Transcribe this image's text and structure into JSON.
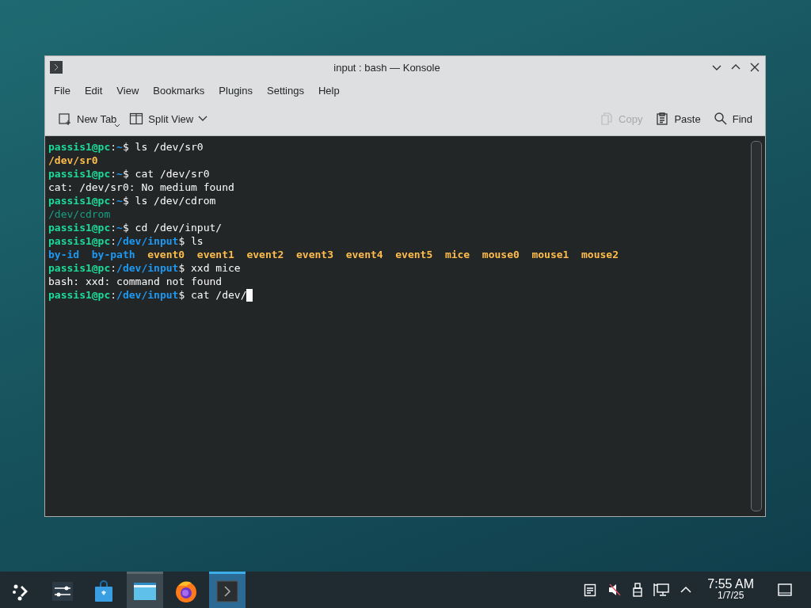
{
  "window": {
    "title": "input : bash — Konsole"
  },
  "menu": [
    "File",
    "Edit",
    "View",
    "Bookmarks",
    "Plugins",
    "Settings",
    "Help"
  ],
  "toolbar": [
    {
      "kind": "new-tab",
      "label": "New Tab",
      "disabled": false
    },
    {
      "kind": "split-view",
      "label": "Split View",
      "disabled": false
    },
    {
      "kind": "copy",
      "label": "Copy",
      "disabled": true
    },
    {
      "kind": "paste",
      "label": "Paste",
      "disabled": false
    },
    {
      "kind": "find",
      "label": "Find",
      "disabled": false
    }
  ],
  "terminal": {
    "lines": [
      {
        "kind": "command",
        "segments": [
          {
            "text": "passis1@pc",
            "kind": "user"
          },
          {
            "text": ":",
            "kind": "plain"
          },
          {
            "text": "~",
            "kind": "path"
          },
          {
            "text": "$ ls /dev/sr0",
            "kind": "plain"
          }
        ]
      },
      {
        "kind": "output",
        "segments": [
          {
            "text": "/dev/sr0",
            "kind": "device"
          }
        ]
      },
      {
        "kind": "command",
        "segments": [
          {
            "text": "passis1@pc",
            "kind": "user"
          },
          {
            "text": ":",
            "kind": "plain"
          },
          {
            "text": "~",
            "kind": "path"
          },
          {
            "text": "$ cat /dev/sr0",
            "kind": "plain"
          }
        ]
      },
      {
        "kind": "output",
        "segments": [
          {
            "text": "cat: /dev/sr0: No medium found",
            "kind": "plain"
          }
        ]
      },
      {
        "kind": "command",
        "segments": [
          {
            "text": "passis1@pc",
            "kind": "user"
          },
          {
            "text": ":",
            "kind": "plain"
          },
          {
            "text": "~",
            "kind": "path"
          },
          {
            "text": "$ ls /dev/cdrom",
            "kind": "plain"
          }
        ]
      },
      {
        "kind": "output",
        "segments": [
          {
            "text": "/dev/cdrom",
            "kind": "link"
          }
        ]
      },
      {
        "kind": "command",
        "segments": [
          {
            "text": "passis1@pc",
            "kind": "user"
          },
          {
            "text": ":",
            "kind": "plain"
          },
          {
            "text": "~",
            "kind": "path"
          },
          {
            "text": "$ cd /dev/input/",
            "kind": "plain"
          }
        ]
      },
      {
        "kind": "command",
        "segments": [
          {
            "text": "passis1@pc",
            "kind": "user"
          },
          {
            "text": ":",
            "kind": "plain"
          },
          {
            "text": "/dev/input",
            "kind": "path"
          },
          {
            "text": "$ ls",
            "kind": "plain"
          }
        ]
      },
      {
        "kind": "listing",
        "segments": [
          {
            "text": "by-id",
            "kind": "directory"
          },
          {
            "text": "by-path",
            "kind": "directory"
          },
          {
            "text": "event0",
            "kind": "device"
          },
          {
            "text": "event1",
            "kind": "device"
          },
          {
            "text": "event2",
            "kind": "device"
          },
          {
            "text": "event3",
            "kind": "device"
          },
          {
            "text": "event4",
            "kind": "device"
          },
          {
            "text": "event5",
            "kind": "device"
          },
          {
            "text": "mice",
            "kind": "device"
          },
          {
            "text": "mouse0",
            "kind": "device"
          },
          {
            "text": "mouse1",
            "kind": "device"
          },
          {
            "text": "mouse2",
            "kind": "device"
          }
        ]
      },
      {
        "kind": "command",
        "segments": [
          {
            "text": "passis1@pc",
            "kind": "user"
          },
          {
            "text": ":",
            "kind": "plain"
          },
          {
            "text": "/dev/input",
            "kind": "path"
          },
          {
            "text": "$ xxd mice",
            "kind": "plain"
          }
        ]
      },
      {
        "kind": "output",
        "segments": [
          {
            "text": "bash: xxd: command not found",
            "kind": "plain"
          }
        ]
      },
      {
        "kind": "command",
        "segments": [
          {
            "text": "passis1@pc",
            "kind": "user"
          },
          {
            "text": ":",
            "kind": "plain"
          },
          {
            "text": "/dev/input",
            "kind": "path"
          },
          {
            "text": "$ cat /dev/",
            "kind": "plain"
          }
        ]
      }
    ]
  },
  "taskbar": {
    "items": [
      {
        "kind": "launcher",
        "selected": false,
        "running": false
      },
      {
        "kind": "settings",
        "selected": false,
        "running": false
      },
      {
        "kind": "store",
        "selected": false,
        "running": false
      },
      {
        "kind": "files",
        "selected": false,
        "running": true
      },
      {
        "kind": "browser",
        "selected": false,
        "running": false
      },
      {
        "kind": "terminal",
        "selected": true,
        "running": true
      }
    ],
    "tray": [
      {
        "kind": "clipboard"
      },
      {
        "kind": "volume-muted"
      },
      {
        "kind": "usb"
      },
      {
        "kind": "network"
      },
      {
        "kind": "expand"
      }
    ],
    "time": "7:55 AM",
    "date": "1/7/25"
  }
}
